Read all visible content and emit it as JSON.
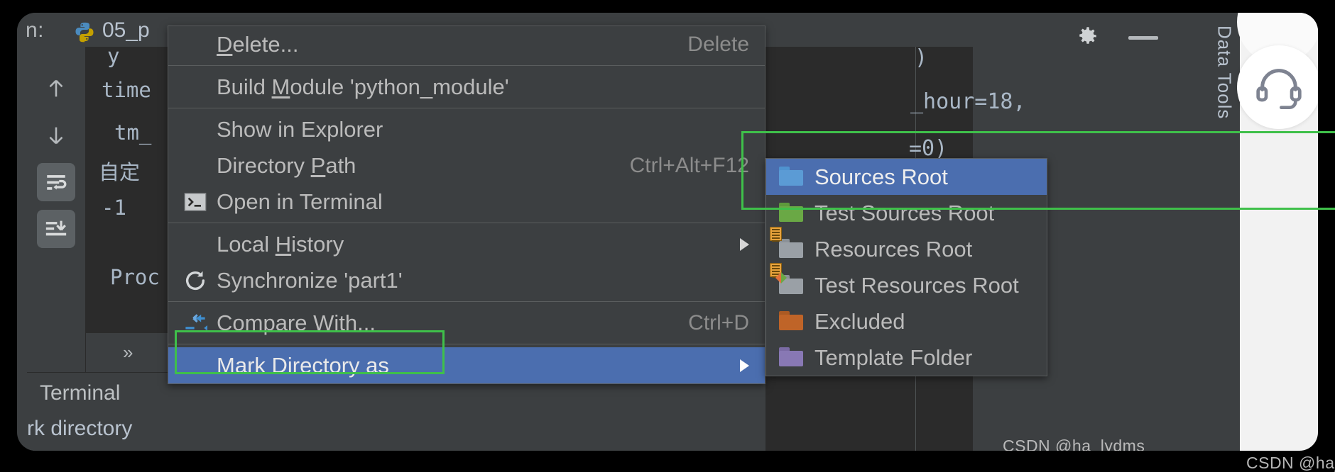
{
  "window": {
    "run_label": "n:",
    "run_config": "05_p",
    "python_icon": "python-logo-icon",
    "gear_icon": "gear-icon",
    "minimize_icon": "minimize-icon"
  },
  "console": {
    "lines": [
      "y",
      "time",
      "tm_",
      "自定",
      "-1",
      "Proc"
    ],
    "gutter": [
      {
        "name": "scroll-up-icon",
        "glyph": "↑"
      },
      {
        "name": "scroll-down-icon",
        "glyph": "↓"
      },
      {
        "name": "soft-wrap-icon",
        "glyph": "wrap"
      },
      {
        "name": "scroll-to-end-icon",
        "glyph": "end"
      }
    ],
    "chevron_label": "»"
  },
  "editor": {
    "lines": [
      ")",
      "_hour=18,",
      "=0)"
    ]
  },
  "right_panel": {
    "vertical_label": "Data Tools",
    "avatar_icon": "headset-icon"
  },
  "bottom": {
    "terminal_tab": "Terminal",
    "message": "rk directory"
  },
  "context_menu": {
    "items": [
      {
        "label": "Delete...",
        "mnemonic": "D",
        "accel": "Delete",
        "icon": null,
        "separator_after": true,
        "selected": false,
        "submenu": false
      },
      {
        "label": "Build Module 'python_module'",
        "mnemonic": "M",
        "accel": "",
        "icon": null,
        "separator_after": true,
        "selected": false,
        "submenu": false
      },
      {
        "label": "Show in Explorer",
        "mnemonic": "",
        "accel": "",
        "icon": null,
        "separator_after": false,
        "selected": false,
        "submenu": false
      },
      {
        "label": "Directory Path",
        "mnemonic": "P",
        "accel": "Ctrl+Alt+F12",
        "icon": null,
        "separator_after": false,
        "selected": false,
        "submenu": false
      },
      {
        "label": "Open in Terminal",
        "mnemonic": "",
        "accel": "",
        "icon": "terminal-icon",
        "separator_after": true,
        "selected": false,
        "submenu": false
      },
      {
        "label": "Local History",
        "mnemonic": "H",
        "accel": "",
        "icon": null,
        "separator_after": false,
        "selected": false,
        "submenu": true
      },
      {
        "label": "Synchronize 'part1'",
        "mnemonic": "",
        "accel": "",
        "icon": "refresh-icon",
        "separator_after": true,
        "selected": false,
        "submenu": false
      },
      {
        "label": "Compare With...",
        "mnemonic": "",
        "accel": "Ctrl+D",
        "icon": "compare-icon",
        "separator_after": true,
        "selected": false,
        "submenu": false
      },
      {
        "label": "Mark Directory as",
        "mnemonic": "",
        "accel": "",
        "icon": null,
        "separator_after": false,
        "selected": true,
        "submenu": true
      }
    ]
  },
  "submenu": {
    "items": [
      {
        "label": "Sources Root",
        "icon": "folder-blue-icon",
        "color": "#5b9bd5",
        "selected": true,
        "badge": "none"
      },
      {
        "label": "Test Sources Root",
        "icon": "folder-green-icon",
        "color": "#6aa845",
        "selected": false,
        "badge": "none"
      },
      {
        "label": "Resources Root",
        "icon": "folder-gray-resources-icon",
        "color": "#9aa0a6",
        "selected": false,
        "badge": "lines"
      },
      {
        "label": "Test Resources Root",
        "icon": "folder-gray-test-resources-icon",
        "color": "#9aa0a6",
        "selected": false,
        "badge": "lines-diamond"
      },
      {
        "label": "Excluded",
        "icon": "folder-orange-icon",
        "color": "#bf6428",
        "selected": false,
        "badge": "none"
      },
      {
        "label": "Template Folder",
        "icon": "folder-purple-icon",
        "color": "#8878b4",
        "selected": false,
        "badge": "none"
      }
    ]
  },
  "annotations": {
    "box_color": "#3fc04a",
    "mark_directory_box": "Mark Directory as",
    "sources_root_box": "Sources Root"
  },
  "watermarks": {
    "inner": "CSDN @ha_lydms",
    "outer": "CSDN @ha_lydms"
  },
  "colors": {
    "menu_bg": "#3c3f41",
    "menu_selected": "#4b6eaf",
    "console_bg": "#2b2b2b",
    "accent_green": "#3fc04a",
    "text": "#bbbbbb"
  }
}
